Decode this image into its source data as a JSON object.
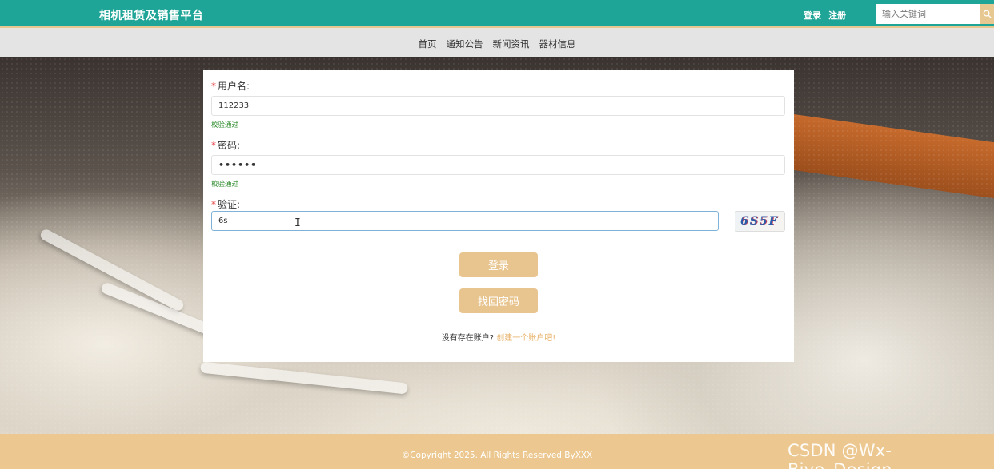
{
  "header": {
    "brand": "相机租赁及销售平台",
    "login_label": "登录",
    "register_label": "注册",
    "search_placeholder": "输入关键词",
    "search_icon": "search-icon"
  },
  "nav": {
    "items": [
      {
        "label": "首页"
      },
      {
        "label": "通知公告"
      },
      {
        "label": "新闻资讯"
      },
      {
        "label": "器材信息"
      }
    ]
  },
  "form": {
    "required_mark": "*",
    "username": {
      "label": "用户名:",
      "value": "112233",
      "validation": "校验通过"
    },
    "password": {
      "label": "密码:",
      "value": "••••••",
      "validation": "校验通过"
    },
    "captcha": {
      "label": "验证:",
      "value": "6s",
      "image_text": "6S5F"
    },
    "login_button": "登录",
    "recover_button": "找回密码",
    "register_prompt": "没有存在账户?",
    "register_link": "创建一个账户吧!"
  },
  "footer": {
    "copyright": "©Copyright 2025. All Rights Reserved ByXXX"
  },
  "watermark": "CSDN @Wx-Biye_Design",
  "colors": {
    "header_bg": "#1fa597",
    "accent": "#e8c48f",
    "footer_bg": "#ecc890",
    "valid_text": "#2e8b2e",
    "required": "#e4393c"
  }
}
